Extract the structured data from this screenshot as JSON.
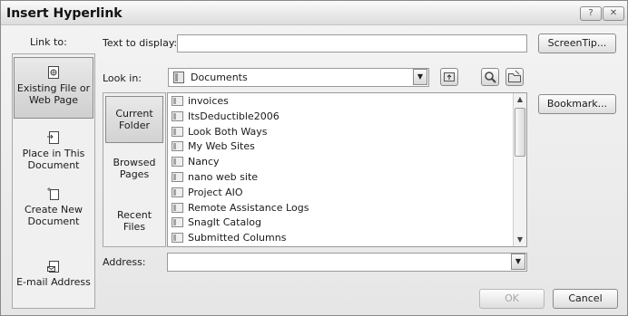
{
  "window": {
    "title": "Insert Hyperlink",
    "help_icon": "?",
    "close_icon": "✕"
  },
  "link_to": {
    "heading": "Link to:",
    "items": [
      {
        "label_lines": [
          "Existing File or",
          "Web Page"
        ],
        "icon": "file-globe-icon",
        "selected": true
      },
      {
        "label_lines": [
          "Place in This",
          "Document"
        ],
        "icon": "document-place-icon",
        "selected": false
      },
      {
        "label_lines": [
          "Create New",
          "Document"
        ],
        "icon": "new-document-icon",
        "selected": false
      },
      {
        "label_lines": [
          "E-mail Address"
        ],
        "icon": "email-icon",
        "selected": false
      }
    ]
  },
  "text_to_display": {
    "label": "Text to display:",
    "value": ""
  },
  "screentip_button": "ScreenTip...",
  "look_in": {
    "label": "Look in:",
    "value": "Documents",
    "folder_icon": "folder-icon"
  },
  "toolbar_icons": [
    "up-folder-icon",
    "browse-web-icon",
    "browse-file-icon"
  ],
  "folder_nav": [
    {
      "label_lines": [
        "Current",
        "Folder"
      ],
      "selected": true
    },
    {
      "label_lines": [
        "Browsed",
        "Pages"
      ],
      "selected": false
    },
    {
      "label_lines": [
        "Recent",
        "Files"
      ],
      "selected": false
    }
  ],
  "files": [
    "invoices",
    "ItsDeductible2006",
    "Look Both Ways",
    "My Web Sites",
    "Nancy",
    "nano web site",
    "Project AIO",
    "Remote Assistance Logs",
    "SnagIt Catalog",
    "Submitted Columns"
  ],
  "bookmark_button": "Bookmark...",
  "address": {
    "label": "Address:",
    "value": ""
  },
  "ok_button": "OK",
  "cancel_button": "Cancel"
}
